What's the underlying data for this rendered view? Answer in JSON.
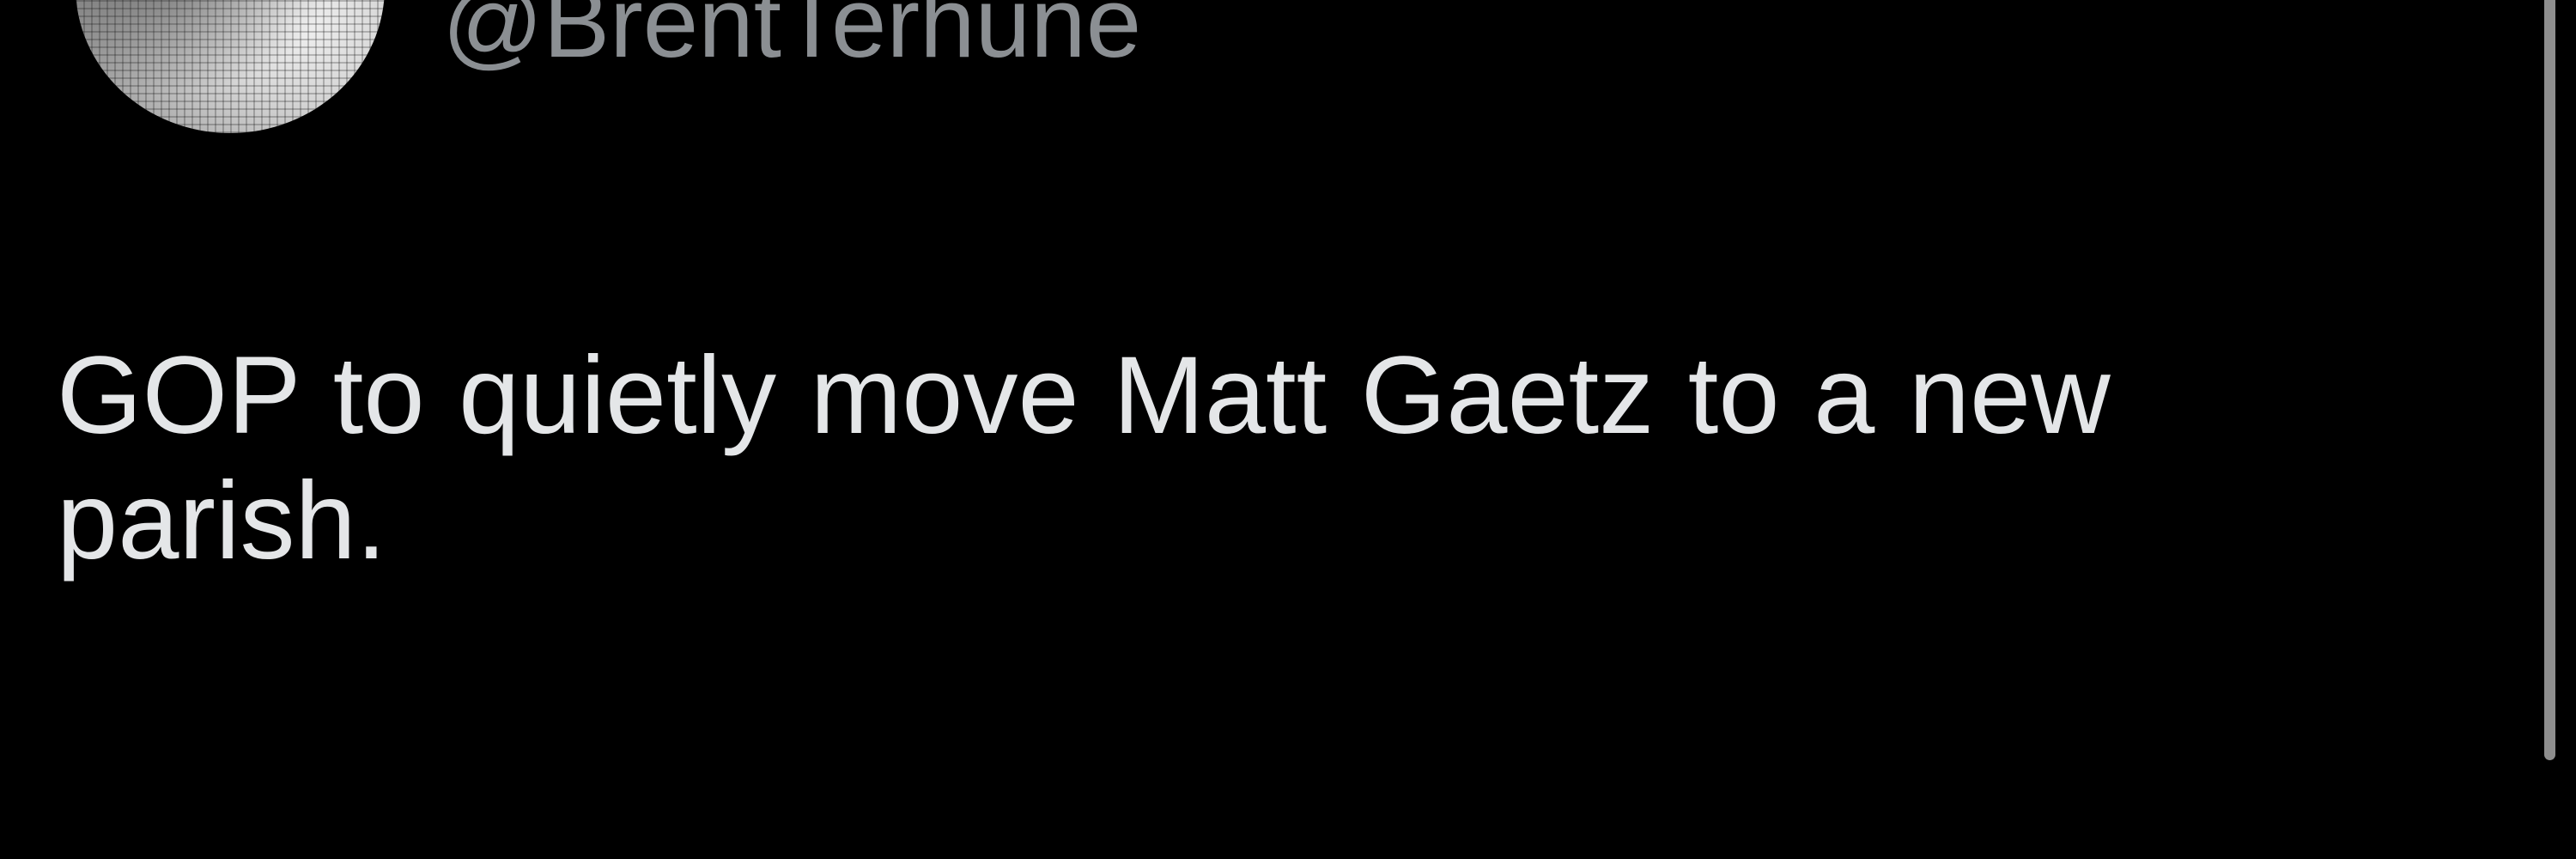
{
  "user": {
    "handle": "@BrentTerhune",
    "avatar_icon": "profile-photo"
  },
  "tweet": {
    "text": "GOP to quietly move Matt Gaetz to a new parish."
  },
  "colors": {
    "background": "#000000",
    "text": "#e4e6e8",
    "handle": "#8b8f93",
    "scrollbar": "#8e8e8e"
  }
}
